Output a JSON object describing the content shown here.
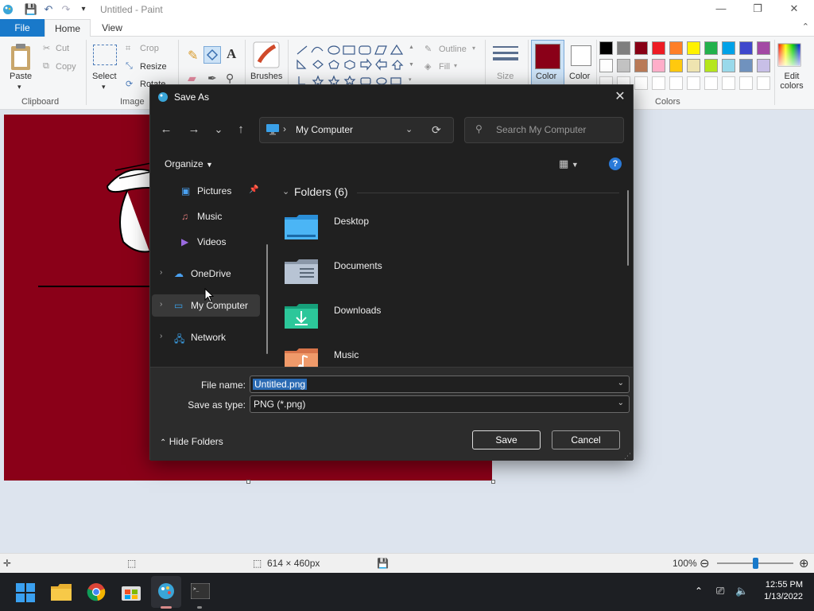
{
  "app": {
    "title": "Untitled - Paint",
    "window_controls": {
      "minimize": "—",
      "maximize": "❐",
      "close": "✕"
    }
  },
  "ribbon": {
    "tabs": [
      "File",
      "Home",
      "View"
    ],
    "clipboard": {
      "paste": "Paste",
      "cut": "Cut",
      "copy": "Copy",
      "group": "Clipboard"
    },
    "image": {
      "select": "Select",
      "crop": "Crop",
      "resize": "Resize",
      "rotate": "Rotate",
      "group": "Image"
    },
    "brushes": "Brushes",
    "shapes": {
      "outline": "Outline",
      "fill": "Fill"
    },
    "size": "Size",
    "color1": {
      "label": "Color",
      "sublabel": "1",
      "value": "#8a0018"
    },
    "color2": {
      "label": "Color",
      "sublabel": "2",
      "value": "#ffffff"
    },
    "colors_group": "Colors",
    "edit_colors": "Edit colors",
    "palette_row1": [
      "#000000",
      "#7f7f7f",
      "#880015",
      "#ed1c24",
      "#ff7f27",
      "#fff200",
      "#22b14c",
      "#00a2e8",
      "#3f48cc",
      "#a349a4"
    ],
    "palette_row2": [
      "#ffffff",
      "#c3c3c3",
      "#b97a57",
      "#ffaec9",
      "#ffc90e",
      "#efe4b0",
      "#b5e61d",
      "#99d9ea",
      "#7092be",
      "#c8bfe7"
    ]
  },
  "dialog": {
    "title": "Save As",
    "nav": {
      "back": "←",
      "forward": "→",
      "recent": "⌄",
      "up": "↑"
    },
    "address": {
      "location": "My Computer",
      "separator": "›",
      "refresh": "⟳"
    },
    "search_placeholder": "Search My Computer",
    "organize": "Organize",
    "help": "?",
    "nav_items": [
      {
        "label": "Pictures",
        "pinned": "📌"
      },
      {
        "label": "Music"
      },
      {
        "label": "Videos"
      },
      {
        "label": "OneDrive"
      },
      {
        "label": "My Computer"
      },
      {
        "label": "Network"
      }
    ],
    "folders_header": "Folders (6)",
    "folders": [
      "Desktop",
      "Documents",
      "Downloads",
      "Music"
    ],
    "file_name_label": "File name:",
    "file_name": "Untitled.png",
    "save_type_label": "Save as type:",
    "save_type": "PNG (*.png)",
    "hide_folders": "Hide Folders",
    "save": "Save",
    "cancel": "Cancel"
  },
  "statusbar": {
    "dimensions": "614 × 460px",
    "zoom": "100%",
    "zoom_out": "⊖",
    "zoom_in": "⊕"
  },
  "taskbar": {
    "time": "12:55 PM",
    "date": "1/13/2022",
    "tray_chevron": "⌃"
  }
}
